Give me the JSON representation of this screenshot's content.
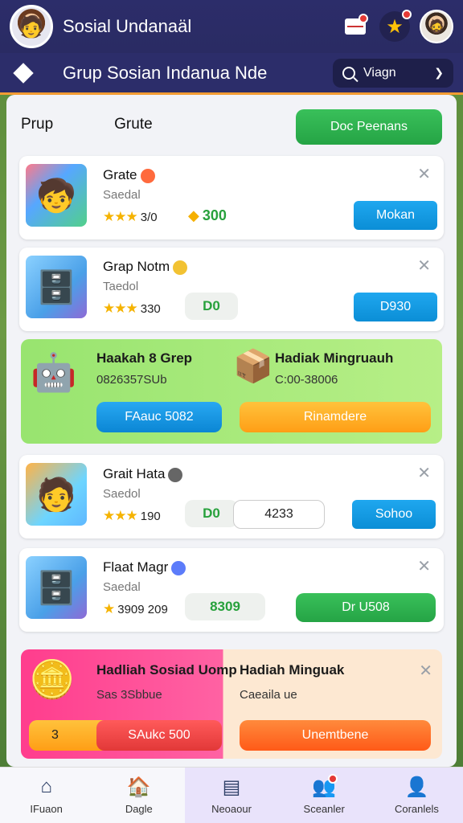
{
  "topbar": {
    "app_title": "Sosial Undanaäl",
    "icons": [
      "avatar",
      "mail-icon",
      "star-icon",
      "profile-icon"
    ]
  },
  "header": {
    "title": "Grup Sosian Indanua Nde",
    "view_label": "Viagn"
  },
  "tabs": {
    "tab1": "Prup",
    "tab2": "Grute",
    "action_label": "Doc Peenans"
  },
  "cards": [
    {
      "title": "Grate",
      "subtitle": "Saedal",
      "rating": "3/0",
      "price": "300",
      "button": "Mokan"
    },
    {
      "title": "Grap Notm",
      "subtitle": "Taedol",
      "rating": "330",
      "price": "D0",
      "button": "D930"
    },
    {
      "title": "Grait Hata",
      "subtitle": "Saedol",
      "rating": "190",
      "price": "D0",
      "input": "4233",
      "button": "Sohoo"
    },
    {
      "title": "Flaat Magr",
      "subtitle": "Saedal",
      "rating": "3909 209",
      "price": "8309",
      "button": "Dr U508"
    }
  ],
  "promo1": {
    "left_title": "Haakah 8 Grep",
    "left_sub": "0826357SUb",
    "left_button": "FAauc 5082",
    "right_title": "Hadiak Mingruauh",
    "right_sub": "C:00-38006",
    "right_button": "Rinamdere"
  },
  "promo2": {
    "left_title": "Hadliah Sosiad Uomp",
    "left_sub": "Sas 3Sbbue",
    "left_badge": "3",
    "left_button": "SAukc 500",
    "right_title": "Hadiah Minguak",
    "right_sub": "Caeaila ue",
    "right_button": "Unemtbene"
  },
  "nav": [
    {
      "label": "IFuaon",
      "icon": "home-icon"
    },
    {
      "label": "Dagle",
      "icon": "house-icon"
    },
    {
      "label": "Neoaour",
      "icon": "card-icon"
    },
    {
      "label": "Sceanler",
      "icon": "people-icon"
    },
    {
      "label": "Coranlels",
      "icon": "person-icon"
    }
  ],
  "colors": {
    "primary": "#2c2d6a",
    "green": "#25a445",
    "blue": "#0b8ed6",
    "accent": "#f39c33"
  }
}
